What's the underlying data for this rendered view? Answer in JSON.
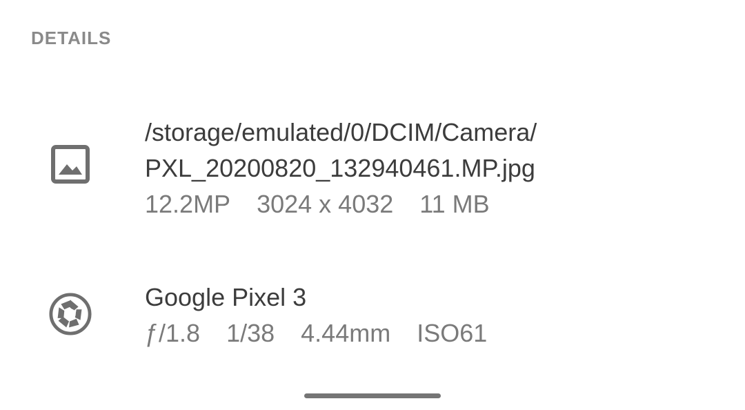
{
  "section": {
    "title": "DETAILS"
  },
  "file": {
    "icon": "image-icon",
    "path_line1": "/storage/emulated/0/DCIM/Camera/",
    "path_line2": "PXL_20200820_132940461.MP.jpg",
    "resolution": "12.2MP",
    "dimensions": "3024 x 4032",
    "size": "11 MB"
  },
  "camera": {
    "icon": "camera-aperture-icon",
    "model": "Google Pixel 3",
    "aperture": "ƒ/1.8",
    "shutter": "1/38",
    "focal_length": "4.44mm",
    "iso": "ISO61"
  },
  "colors": {
    "icon": "#6f6f6f",
    "primary_text": "#3c3c3c",
    "secondary_text": "#7a7a7a",
    "header_text": "#8a8a8a"
  }
}
